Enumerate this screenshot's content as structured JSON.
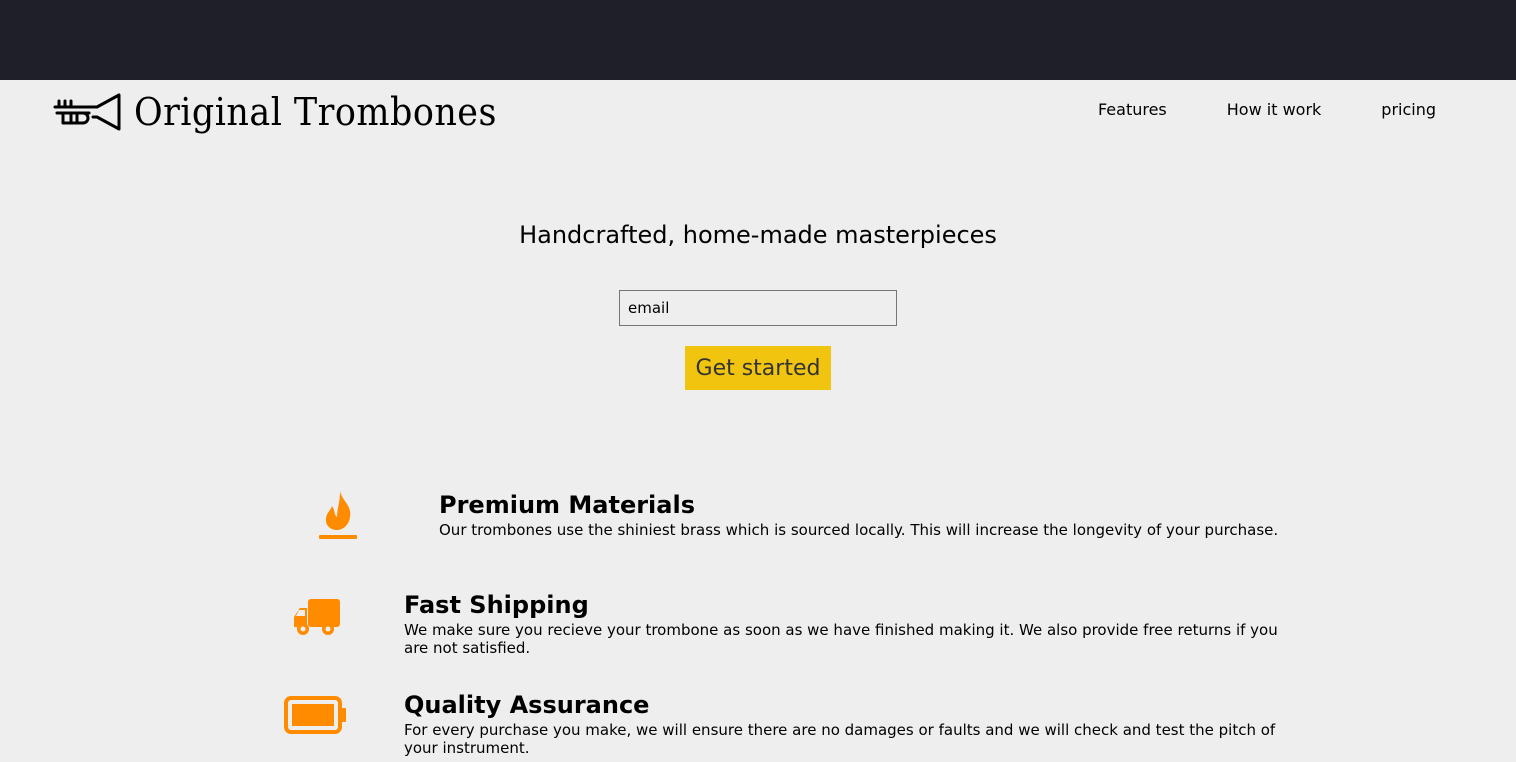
{
  "brand": {
    "name": "Original Trombones",
    "icon": "trumpet-icon"
  },
  "nav": {
    "items": [
      "Features",
      "How it work",
      "pricing"
    ]
  },
  "hero": {
    "title": "Handcrafted, home-made masterpieces",
    "email_placeholder": "email",
    "cta_label": "Get started"
  },
  "features": [
    {
      "icon": "fire-icon",
      "title": "Premium Materials",
      "text": "Our trombones use the shiniest brass which is sourced locally. This will increase the longevity of your purchase."
    },
    {
      "icon": "truck-icon",
      "title": "Fast Shipping",
      "text": "We make sure you recieve your trombone as soon as we have finished making it. We also provide free returns if you are not satisfied."
    },
    {
      "icon": "battery-icon",
      "title": "Quality Assurance",
      "text": "For every purchase you make, we will ensure there are no damages or faults and we will check and test the pitch of your instrument."
    }
  ],
  "colors": {
    "topbar": "#1f1f29",
    "background": "#eeeeee",
    "accent": "#f1c40f",
    "icon": "#ff8c00"
  }
}
